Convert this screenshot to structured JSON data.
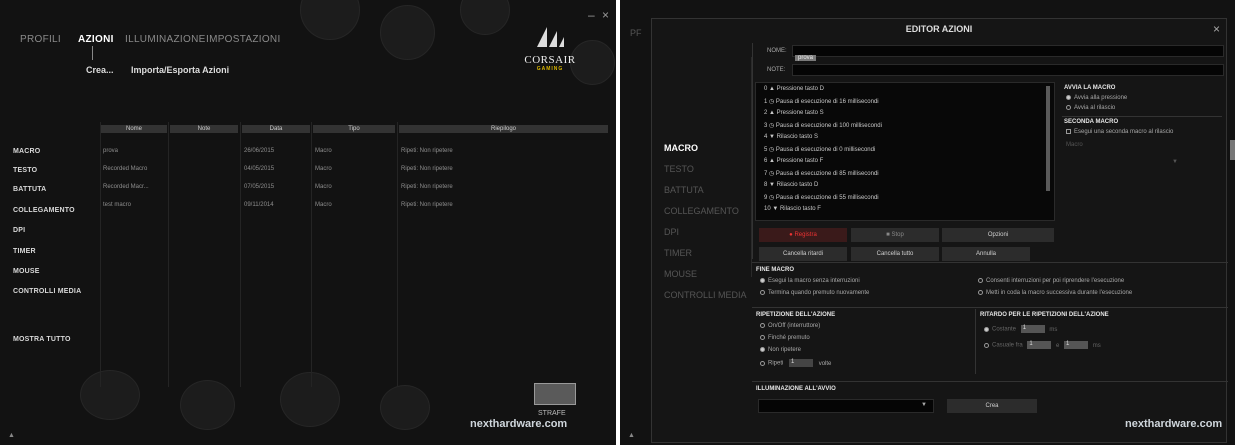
{
  "left": {
    "nav": [
      "PROFILI",
      "AZIONI",
      "ILLUMINAZIONE",
      "IMPOSTAZIONI"
    ],
    "submenu": [
      "Crea...",
      "Importa/Esporta Azioni"
    ],
    "brand": {
      "name": "CORSAIR",
      "sub": "GAMING"
    },
    "sidebar": [
      "MACRO",
      "TESTO",
      "BATTUTA",
      "COLLEGAMENTO",
      "DPI",
      "TIMER",
      "MOUSE",
      "CONTROLLI MEDIA"
    ],
    "show_all": "MOSTRA TUTTO",
    "table": {
      "headers": [
        "Nome",
        "Note",
        "Data",
        "Tipo",
        "Riepilogo"
      ],
      "rows": [
        [
          "prova",
          "",
          "26/06/2015",
          "Macro",
          "Ripeti: Non ripetere"
        ],
        [
          "Recorded Macro",
          "",
          "04/05/2015",
          "Macro",
          "Ripeti: Non ripetere"
        ],
        [
          "Recorded Macr...",
          "",
          "07/05/2015",
          "Macro",
          "Ripeti: Non ripetere"
        ],
        [
          "test macro",
          "",
          "09/11/2014",
          "Macro",
          "Ripeti: Non ripetere"
        ]
      ]
    },
    "device": "STRAFE",
    "watermark": "nexthardware.com",
    "footer_arrow": "▲"
  },
  "right": {
    "title": "EDITOR AZIONI",
    "close": "×",
    "nome_label": "NOME:",
    "nome_value": "prova",
    "note_label": "NOTE:",
    "sidebar": [
      "MACRO",
      "TESTO",
      "BATTUTA",
      "COLLEGAMENTO",
      "DPI",
      "TIMER",
      "MOUSE",
      "CONTROLLI MEDIA"
    ],
    "steps": [
      "0  ▲  Pressione tasto D",
      "1  ◷  Pausa di esecuzione di 16 millisecondi",
      "2  ▲  Pressione tasto S",
      "3  ◷  Pausa di esecuzione di 100 millisecondi",
      "4  ▼  Rilascio tasto S",
      "5  ◷  Pausa di esecuzione di 0 millisecondi",
      "6  ▲  Pressione tasto F",
      "7  ◷  Pausa di esecuzione di 85 millisecondi",
      "8  ▼  Rilascio tasto D",
      "9  ◷  Pausa di esecuzione di 55 millisecondi",
      "10  ▼  Rilascio tasto F"
    ],
    "buttons": {
      "record": "● Registra",
      "stop": "■ Stop",
      "options": "Opzioni",
      "clear_delays": "Cancella ritardi",
      "clear_all": "Cancella tutto",
      "undo": "Annulla"
    },
    "avvia": {
      "title": "AVVIA LA MACRO",
      "opt1": "Avvia alla pressione",
      "opt2": "Avvia al rilascio"
    },
    "seconda": {
      "title": "SECONDA MACRO",
      "check": "Esegui una seconda macro al rilascio",
      "field": "Macro"
    },
    "fine": {
      "title": "FINE MACRO",
      "opt1": "Esegui la macro senza interruzioni",
      "opt2": "Termina quando premuto nuovamente",
      "opt3": "Consenti interruzioni per poi riprendere l'esecuzione",
      "opt4": "Metti in coda la macro successiva durante l'esecuzione"
    },
    "ripetizione": {
      "title": "RIPETIZIONE DELL'AZIONE",
      "opts": [
        "On/Off (interruttore)",
        "Finché premuto",
        "Non ripetere",
        "Ripeti"
      ],
      "ripeti_value": "1",
      "volte": "volte"
    },
    "ritardo": {
      "title": "RITARDO PER LE RIPETIZIONI DELL'AZIONE",
      "costante": "Costante",
      "costante_val": "1",
      "casuale": "Casuale fra",
      "casuale_a": "1",
      "e": "e",
      "casuale_b": "1",
      "ms": "ms"
    },
    "illum": {
      "title": "ILLUMINAZIONE ALL'AVVIO",
      "create": "Crea"
    },
    "watermark": "nexthardware.com",
    "footer_arrow": "▲"
  }
}
